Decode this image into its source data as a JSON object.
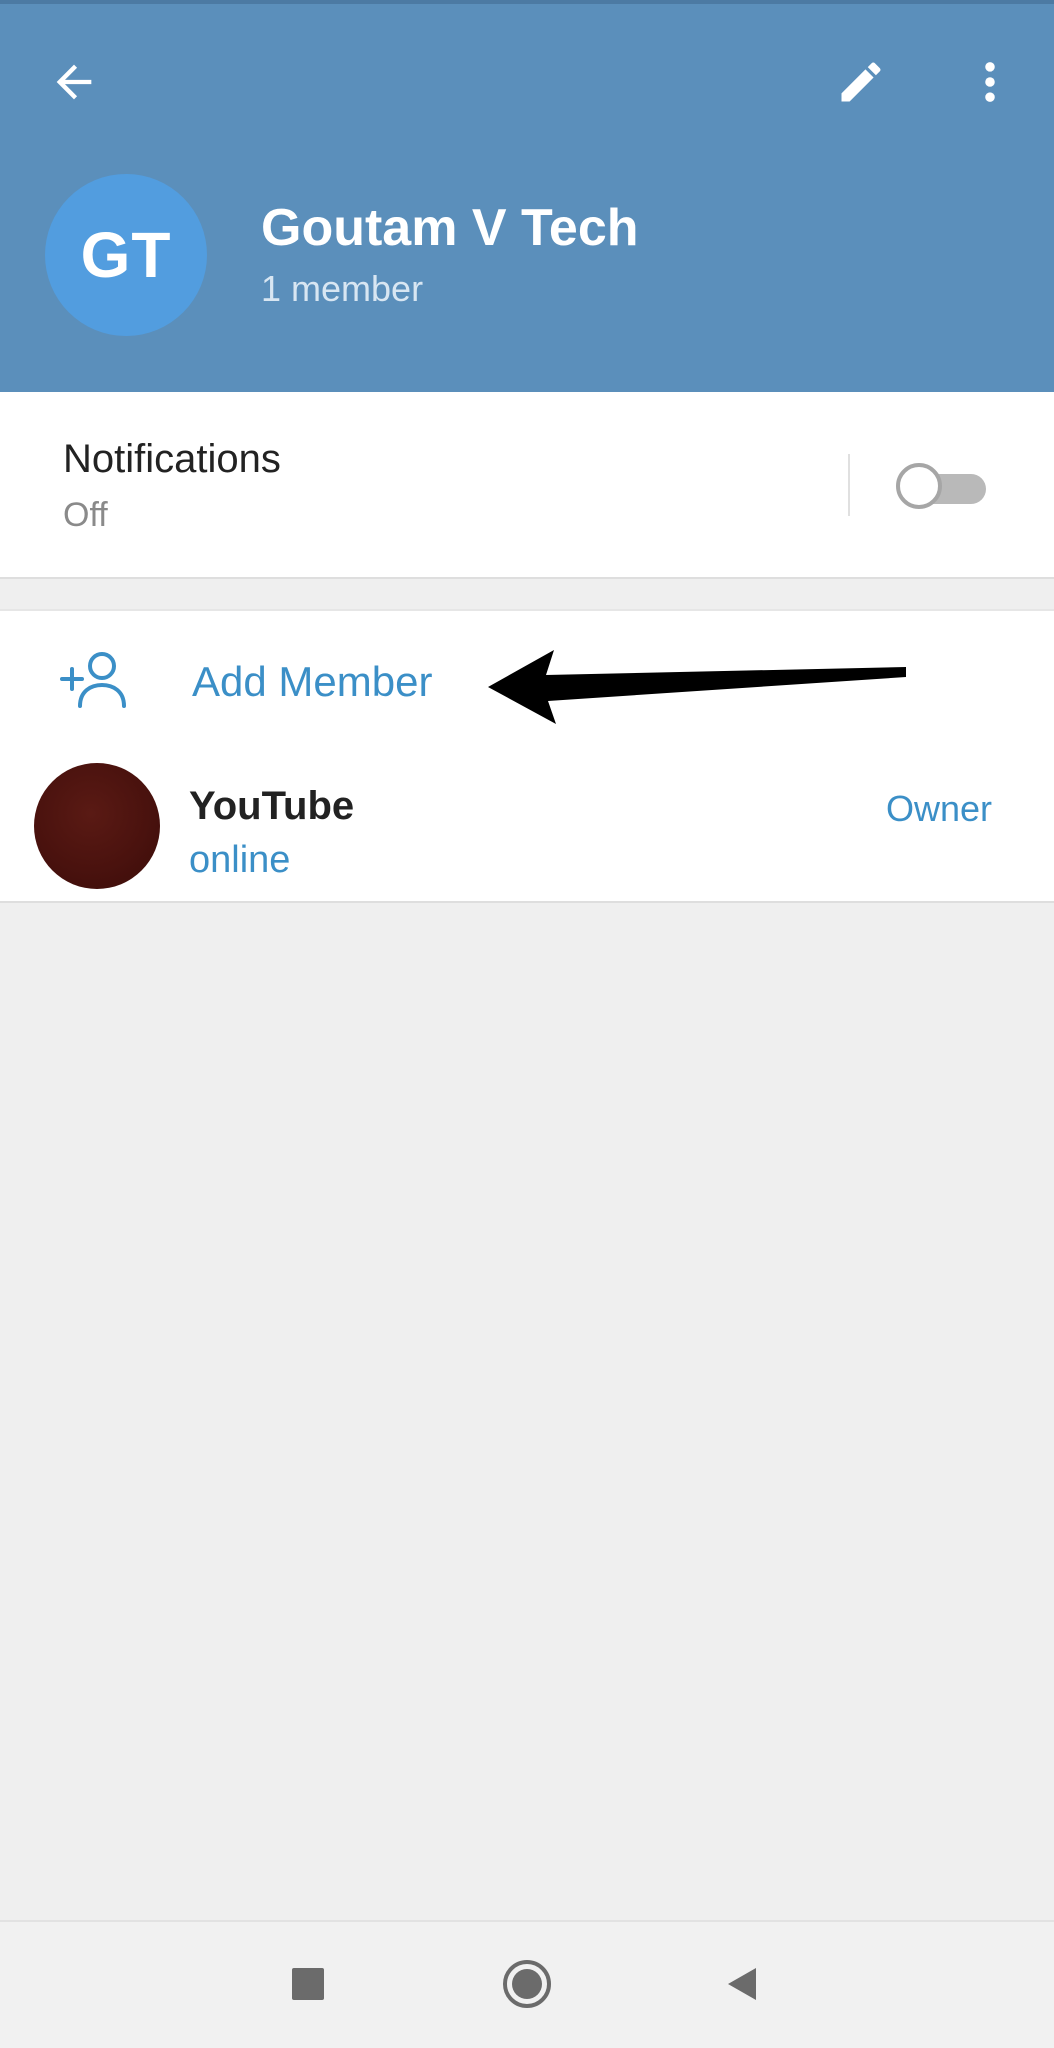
{
  "header": {
    "back_icon": "arrow-back-icon",
    "edit_icon": "pencil-icon",
    "more_icon": "more-vertical-icon",
    "avatar_initials": "GT",
    "avatar_color": "#529ddf",
    "title": "Goutam V Tech",
    "subtitle": "1 member",
    "background_color": "#5b8fbb"
  },
  "notifications": {
    "title": "Notifications",
    "status": "Off",
    "enabled": false
  },
  "members": {
    "add_member_label": "Add Member",
    "add_member_icon": "add-person-icon",
    "accent_color": "#3b8fc7",
    "list": [
      {
        "name": "YouTube",
        "status": "online",
        "role": "Owner"
      }
    ]
  },
  "annotation": {
    "arrow_icon": "arrow-left-annotation"
  },
  "navigation_bar": {
    "recents_icon": "square-recents-icon",
    "home_icon": "circle-home-icon",
    "back_icon": "triangle-back-icon"
  }
}
